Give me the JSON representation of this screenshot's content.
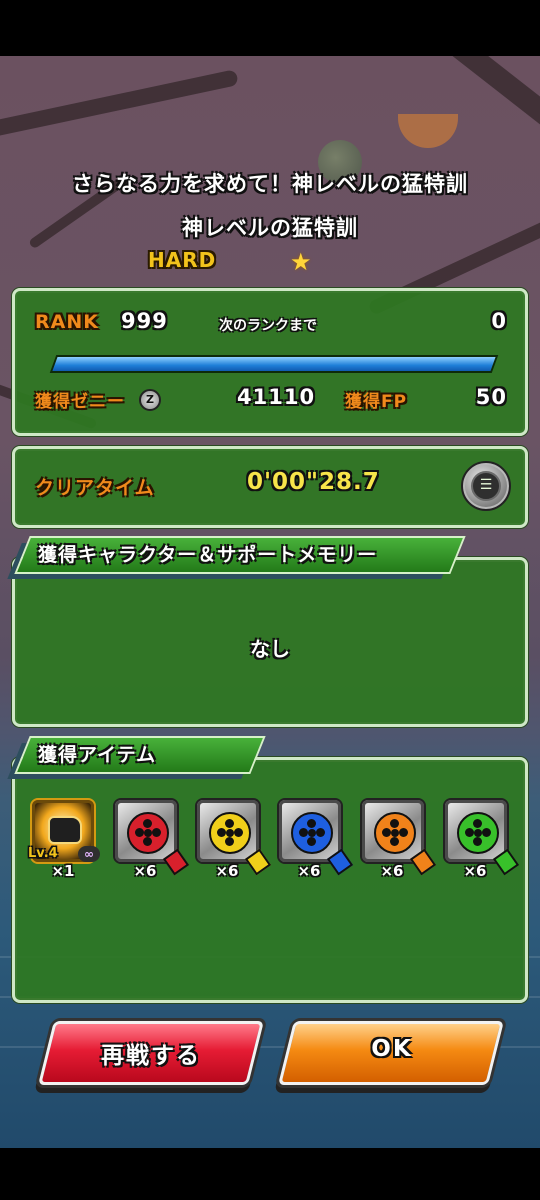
{
  "header": {
    "event_title": "さらなる力を求めて！神レベルの猛特訓",
    "stage_title": "神レベルの猛特訓",
    "difficulty": "HARD",
    "difficulty_star": "★"
  },
  "rank_panel": {
    "rank_label": "RANK",
    "rank_value": "999",
    "next_rank_label": "次のランクまで",
    "next_rank_value": "0",
    "rank_progress": 1.0,
    "zeni_label": "獲得ゼニー",
    "zeni_value": "41110",
    "fp_label": "獲得FP",
    "fp_value": "50"
  },
  "time_panel": {
    "label": "クリアタイム",
    "value": "0'00\"28.7",
    "list_icon": "list-icon"
  },
  "characters_panel": {
    "tab_label": "獲得キャラクター＆サポートメモリー",
    "empty_text": "なし"
  },
  "items_panel": {
    "tab_label": "獲得アイテム",
    "items": [
      {
        "name": "fist-item",
        "qty": "×1",
        "level": "Lv.4",
        "badge": "∞"
      },
      {
        "name": "red-film-reel",
        "qty": "×6",
        "color": "#d8202c"
      },
      {
        "name": "yellow-film-reel",
        "qty": "×6",
        "color": "#f0cf1a"
      },
      {
        "name": "blue-film-reel",
        "qty": "×6",
        "color": "#1e5fe0"
      },
      {
        "name": "orange-film-reel",
        "qty": "×6",
        "color": "#f0821a"
      },
      {
        "name": "green-film-reel",
        "qty": "×6",
        "color": "#38c02a"
      }
    ]
  },
  "buttons": {
    "retry": "再戦する",
    "ok": "OK"
  }
}
